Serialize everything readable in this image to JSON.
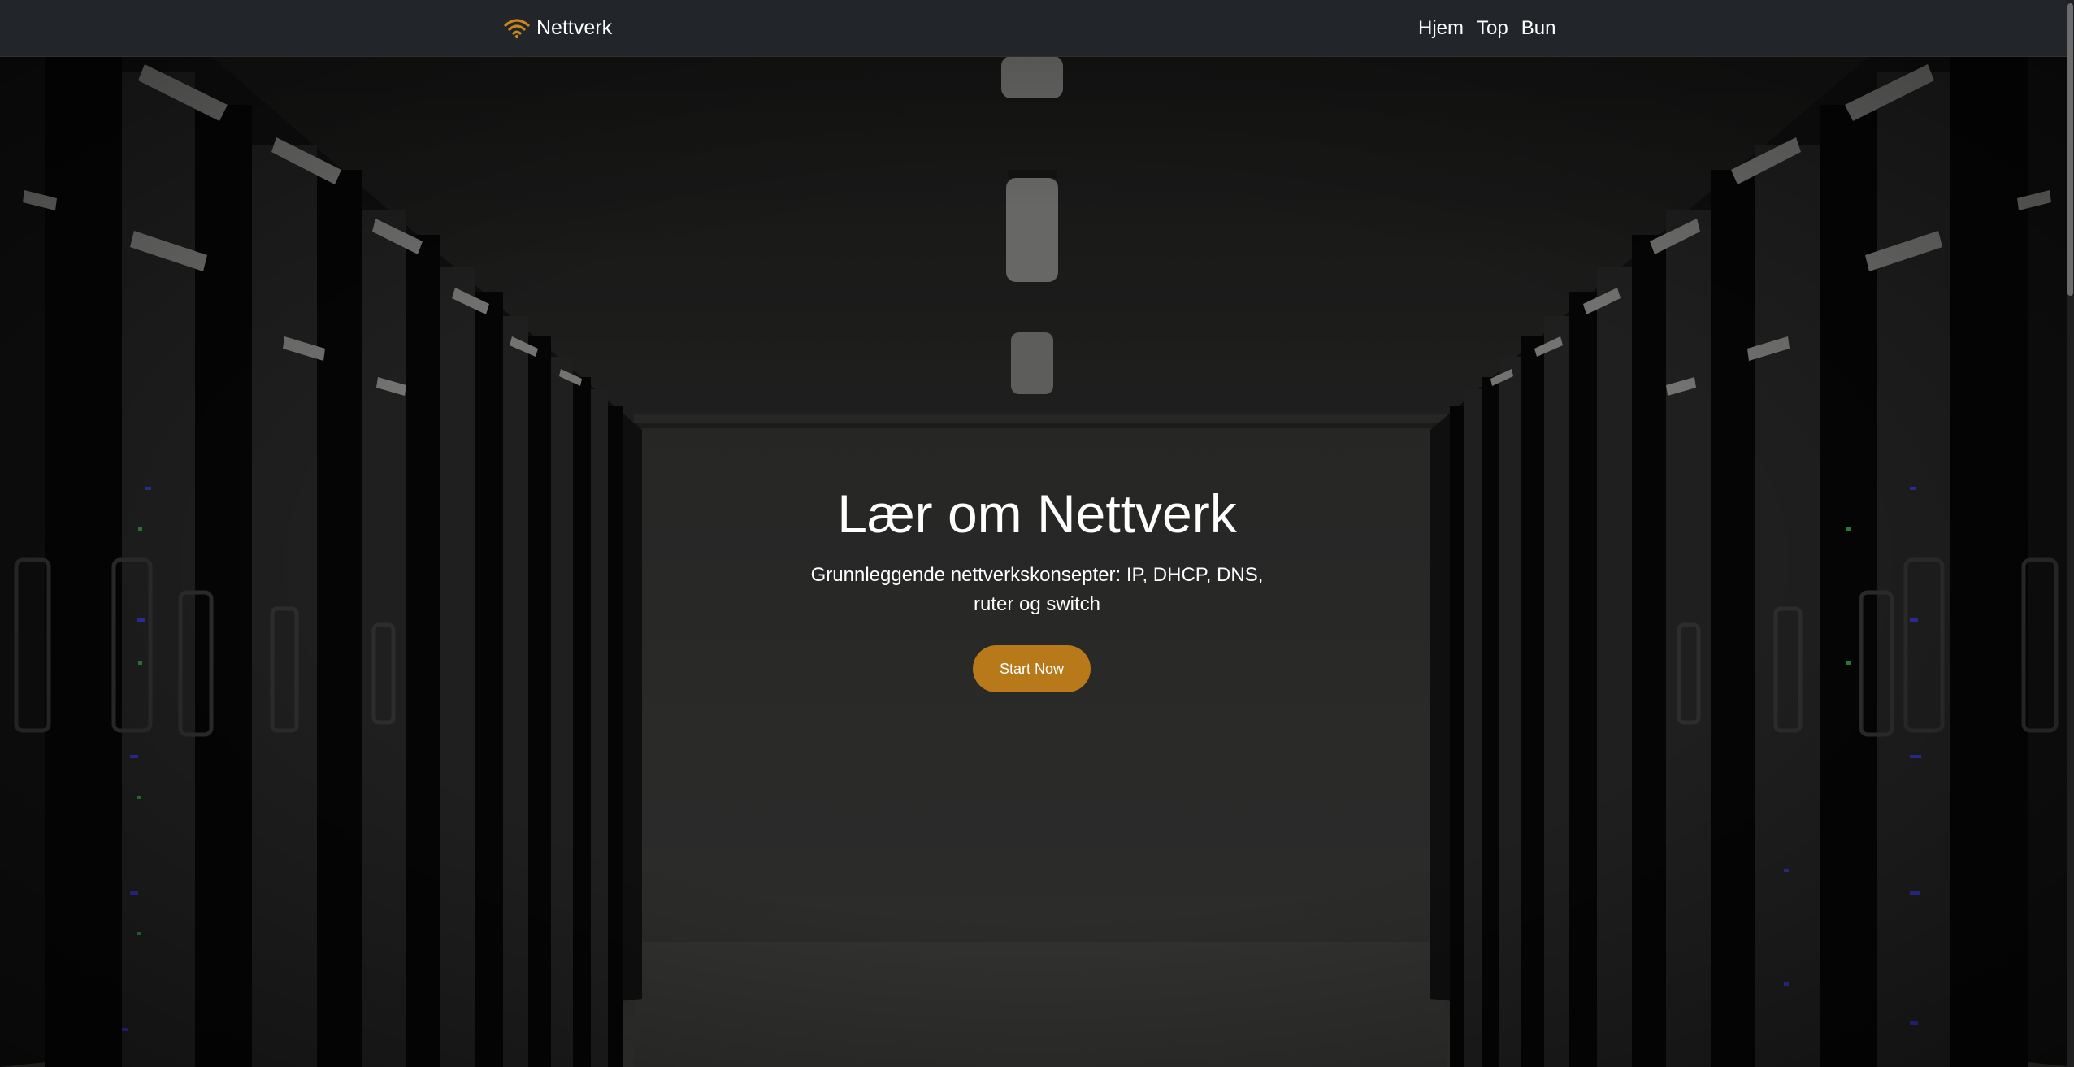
{
  "navbar": {
    "brand_label": "Nettverk",
    "brand_icon": "wifi-icon",
    "links": [
      {
        "label": "Hjem"
      },
      {
        "label": "Top"
      },
      {
        "label": "Bun"
      }
    ]
  },
  "hero": {
    "title": "Lær om Nettverk",
    "subtitle": "Grunnleggende nettverkskonsepter: IP, DHCP, DNS, ruter og switch",
    "button_label": "Start Now"
  },
  "colors": {
    "navbar_bg": "#22262a",
    "accent": "#b7791a",
    "text": "#ffffff"
  }
}
